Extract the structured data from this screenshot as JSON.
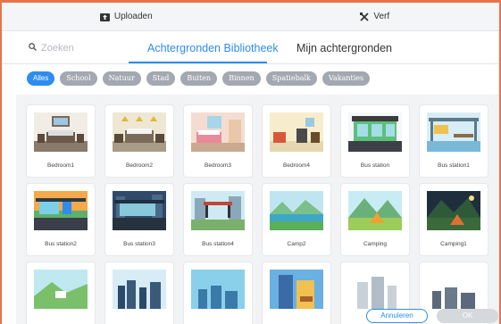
{
  "topbar": {
    "upload_label": "Uploaden",
    "paint_label": "Verf"
  },
  "search": {
    "placeholder": "Zoeken"
  },
  "tabs": {
    "library": "Achtergronden Bibliotheek",
    "mine": "Mijn achtergronden"
  },
  "filters": [
    "Alles",
    "School",
    "Natuur",
    "Stad",
    "Buiten",
    "Binnen",
    "Spatiebalk",
    "Vakanties"
  ],
  "cards": [
    "Bedroom1",
    "Bedroom2",
    "Bedroom3",
    "Bedroom4",
    "Bus station",
    "Bus station1",
    "Bus station2",
    "Bus station3",
    "Bus station4",
    "Camp2",
    "Camping",
    "Camping1"
  ],
  "footer": {
    "cancel": "Annuleren",
    "ok": "OK"
  },
  "colors": {
    "accent": "#2d8cf0",
    "frame": "#e8734a",
    "chip": "#a3a8b1"
  }
}
